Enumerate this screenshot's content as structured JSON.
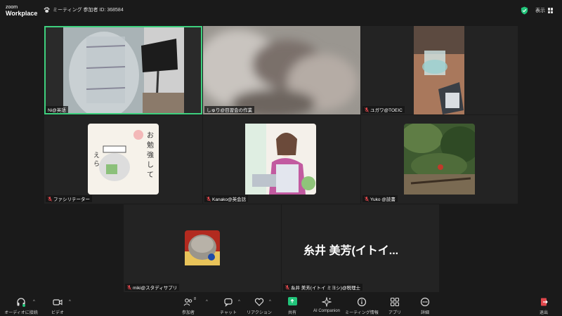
{
  "app": {
    "logo_line1": "zoom",
    "logo_line2": "Workplace",
    "meeting_info": "ミーティング 参加者 ID: 368584",
    "view_label": "表示"
  },
  "participants": [
    {
      "name": "Ni@英語"
    },
    {
      "name": "しゅり@目習会の作業"
    },
    {
      "name": "ユガワ@TOEIC"
    },
    {
      "name": "ファシリテーター"
    },
    {
      "name": "Kanako@英会話"
    },
    {
      "name": "Yuko @読書"
    },
    {
      "name": "miki@スタディサプリ"
    },
    {
      "name": "糸井 美芳(イトイ ミヨシ)@税理士",
      "display_name": "糸井 美芳(イトイ..."
    }
  ],
  "toolbar": {
    "audio": "オーディオに接続",
    "video": "ビデオ",
    "participants": "参加者",
    "participants_count": "8",
    "chat": "チャット",
    "reactions": "リアクション",
    "share": "共有",
    "ai": "AI Companion",
    "meeting_info": "ミーティング情報",
    "apps": "アプリ",
    "more": "詳細",
    "leave": "退出"
  },
  "colors": {
    "active_speaker": "#3ed07e",
    "share_green": "#21c47a",
    "leave_red": "#e0474c",
    "muted_red": "#e0474c"
  }
}
